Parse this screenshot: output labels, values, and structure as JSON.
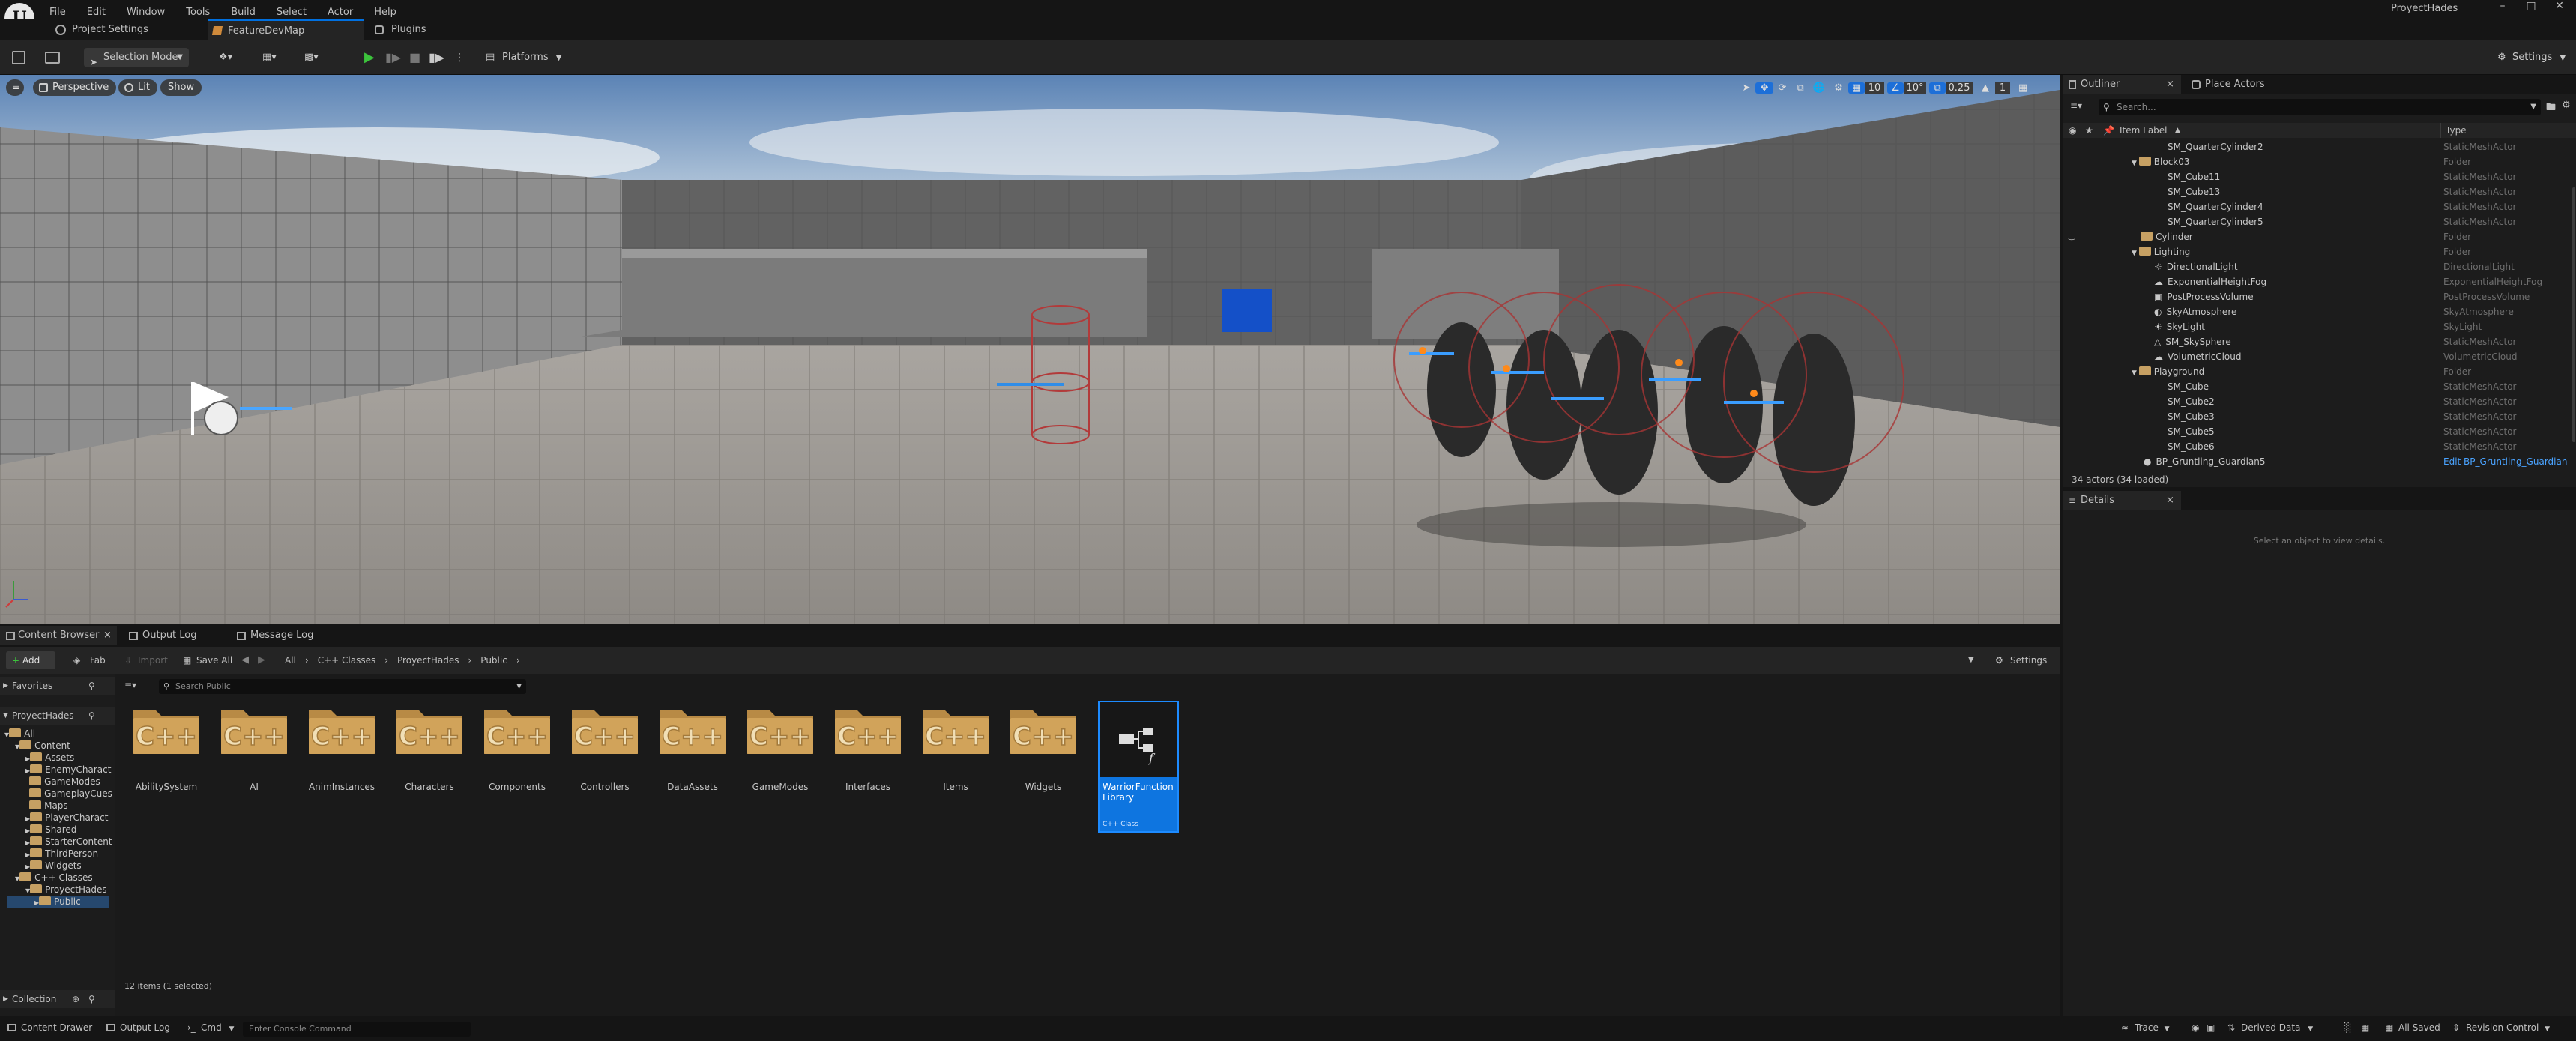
{
  "app": {
    "title": "ProyectHades"
  },
  "menu": [
    "File",
    "Edit",
    "Window",
    "Tools",
    "Build",
    "Select",
    "Actor",
    "Help"
  ],
  "tabs": {
    "project_settings": "Project Settings",
    "map": "FeatureDevMap",
    "plugins": "Plugins"
  },
  "toolbar": {
    "mode": "Selection Mode",
    "platforms": "Platforms",
    "settings": "Settings"
  },
  "viewport": {
    "perspective": "Perspective",
    "lit": "Lit",
    "show": "Show",
    "grid_snap": "10",
    "rot_snap": "10°",
    "scale_snap": "0.25",
    "camera_speed": "1"
  },
  "outliner": {
    "tab": "Outliner",
    "place_actors": "Place Actors",
    "search_placeholder": "Search...",
    "col_label": "Item Label",
    "col_type": "Type",
    "rows": [
      {
        "label": "SM_QuarterCylinder2",
        "type": "StaticMeshActor"
      },
      {
        "label": "Block03",
        "type": "Folder"
      },
      {
        "label": "SM_Cube11",
        "type": "StaticMeshActor"
      },
      {
        "label": "SM_Cube13",
        "type": "StaticMeshActor"
      },
      {
        "label": "SM_QuarterCylinder4",
        "type": "StaticMeshActor"
      },
      {
        "label": "SM_QuarterCylinder5",
        "type": "StaticMeshActor"
      },
      {
        "label": "Cylinder",
        "type": "Folder"
      },
      {
        "label": "Lighting",
        "type": "Folder"
      },
      {
        "label": "DirectionalLight",
        "type": "DirectionalLight"
      },
      {
        "label": "ExponentialHeightFog",
        "type": "ExponentialHeightFog"
      },
      {
        "label": "PostProcessVolume",
        "type": "PostProcessVolume"
      },
      {
        "label": "SkyAtmosphere",
        "type": "SkyAtmosphere"
      },
      {
        "label": "SkyLight",
        "type": "SkyLight"
      },
      {
        "label": "SM_SkySphere",
        "type": "StaticMeshActor"
      },
      {
        "label": "VolumetricCloud",
        "type": "VolumetricCloud"
      },
      {
        "label": "Playground",
        "type": "Folder"
      },
      {
        "label": "SM_Cube",
        "type": "StaticMeshActor"
      },
      {
        "label": "SM_Cube2",
        "type": "StaticMeshActor"
      },
      {
        "label": "SM_Cube3",
        "type": "StaticMeshActor"
      },
      {
        "label": "SM_Cube5",
        "type": "StaticMeshActor"
      },
      {
        "label": "SM_Cube6",
        "type": "StaticMeshActor"
      },
      {
        "label": "BP_Gruntling_Guardian5",
        "type": "Edit BP_Gruntling_Guardian"
      }
    ],
    "actor_count": "34 actors (34 loaded)"
  },
  "details": {
    "tab": "Details",
    "empty": "Select an object to view details."
  },
  "content_browser": {
    "tab": "Content Browser",
    "output_log": "Output Log",
    "message_log": "Message Log",
    "add": "Add",
    "fab": "Fab",
    "import": "Import",
    "save_all": "Save All",
    "breadcrumb": [
      "All",
      "C++ Classes",
      "ProyectHades",
      "Public"
    ],
    "settings": "Settings",
    "favorites": "Favorites",
    "root": "ProyectHades",
    "search_placeholder": "Search Public",
    "tree": [
      "All",
      "Content",
      "Assets",
      "EnemyCharact",
      "GameModes",
      "GameplayCues",
      "Maps",
      "PlayerCharact",
      "Shared",
      "StarterContent",
      "ThirdPerson",
      "Widgets",
      "C++ Classes",
      "ProyectHades",
      "Public"
    ],
    "folders": [
      "AbilitySystem",
      "AI",
      "AnimInstances",
      "Characters",
      "Components",
      "Controllers",
      "DataAssets",
      "GameModes",
      "Interfaces",
      "Items",
      "Widgets"
    ],
    "selected_asset": {
      "name": "WarriorFunction Library",
      "kind": "C++ Class"
    },
    "item_count": "12 items (1 selected)",
    "collection": "Collection"
  },
  "statusbar": {
    "content_drawer": "Content Drawer",
    "output_log": "Output Log",
    "cmd": "Cmd",
    "console_placeholder": "Enter Console Command",
    "trace": "Trace",
    "derived_data": "Derived Data",
    "all_saved": "All Saved",
    "revision_control": "Revision Control"
  }
}
